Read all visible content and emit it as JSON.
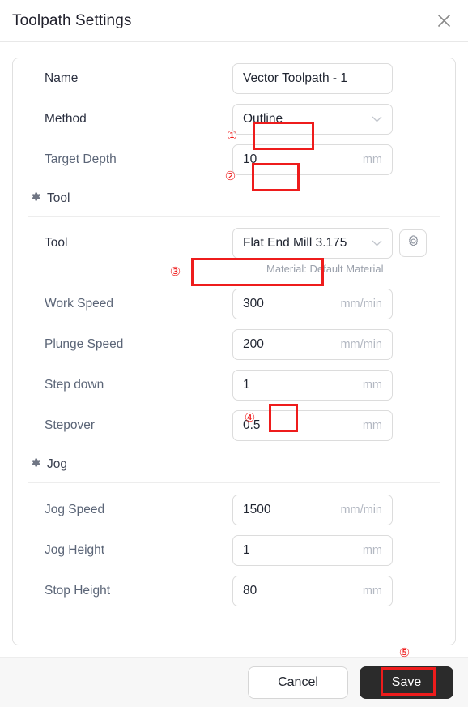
{
  "header": {
    "title": "Toolpath Settings",
    "close_icon": "close-icon"
  },
  "form": {
    "rows": [
      {
        "label": "Name",
        "value": "Vector Toolpath - 1",
        "unit": "",
        "type": "text"
      },
      {
        "label": "Method",
        "value": "Outline",
        "unit": "",
        "type": "select"
      },
      {
        "label": "Target Depth",
        "value": "10",
        "unit": "mm",
        "type": "text"
      }
    ]
  },
  "tool_section": {
    "title": "Tool",
    "icon": "gear-icon",
    "tool_label": "Tool",
    "tool_value": "Flat End Mill 3.175",
    "settings_icon": "gear-icon",
    "material_note": "Material: Default Material",
    "rows": [
      {
        "label": "Work Speed",
        "value": "300",
        "unit": "mm/min"
      },
      {
        "label": "Plunge Speed",
        "value": "200",
        "unit": "mm/min"
      },
      {
        "label": "Step down",
        "value": "1",
        "unit": "mm"
      },
      {
        "label": "Stepover",
        "value": "0.5",
        "unit": "mm"
      }
    ]
  },
  "jog_section": {
    "title": "Jog",
    "icon": "gear-icon",
    "rows": [
      {
        "label": "Jog Speed",
        "value": "1500",
        "unit": "mm/min"
      },
      {
        "label": "Jog Height",
        "value": "1",
        "unit": "mm"
      },
      {
        "label": "Stop Height",
        "value": "80",
        "unit": "mm"
      }
    ]
  },
  "footer": {
    "cancel_label": "Cancel",
    "save_label": "Save"
  },
  "annotations": {
    "color": "#ee1c1c",
    "markers": [
      {
        "number": "①",
        "target": "method-select"
      },
      {
        "number": "②",
        "target": "target-depth-input"
      },
      {
        "number": "③",
        "target": "tool-select"
      },
      {
        "number": "④",
        "target": "step-down-input"
      },
      {
        "number": "⑤",
        "target": "save-button"
      }
    ]
  }
}
